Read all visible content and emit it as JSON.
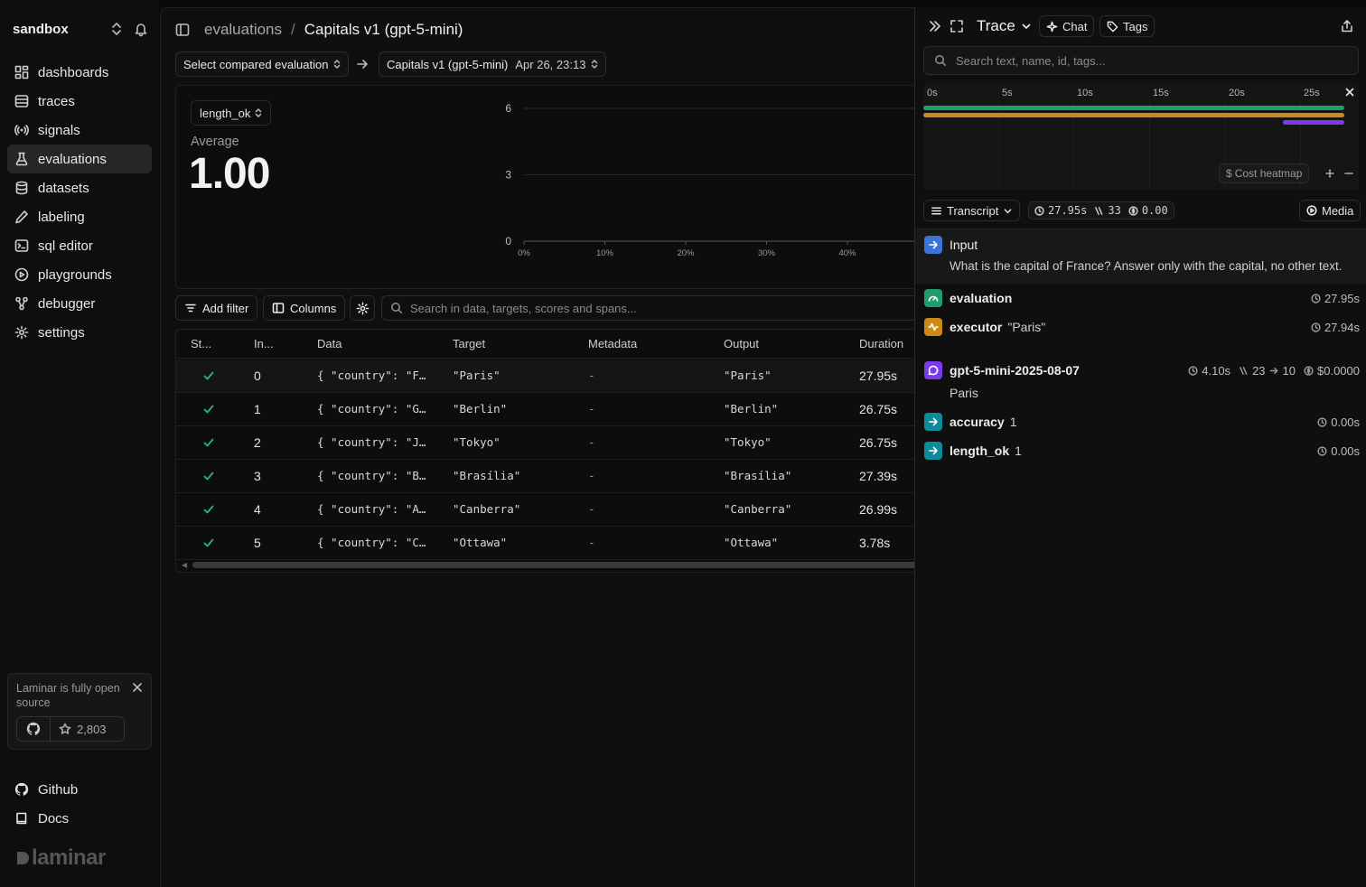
{
  "sidebar": {
    "workspace": "sandbox",
    "items": [
      {
        "label": "dashboards",
        "icon": "dashboard-icon"
      },
      {
        "label": "traces",
        "icon": "list-icon"
      },
      {
        "label": "signals",
        "icon": "signal-icon"
      },
      {
        "label": "evaluations",
        "icon": "flask-icon",
        "active": true
      },
      {
        "label": "datasets",
        "icon": "database-icon"
      },
      {
        "label": "labeling",
        "icon": "pen-icon"
      },
      {
        "label": "sql editor",
        "icon": "terminal-icon"
      },
      {
        "label": "playgrounds",
        "icon": "play-circle-icon"
      },
      {
        "label": "debugger",
        "icon": "share-nodes-icon"
      },
      {
        "label": "settings",
        "icon": "gear-icon"
      }
    ],
    "oss_banner": {
      "text": "Laminar is fully open source",
      "stars": "2,803"
    },
    "footer": {
      "github": "Github",
      "docs": "Docs"
    },
    "brand": "laminar"
  },
  "header": {
    "breadcrumb_parent": "evaluations",
    "breadcrumb_sep": "/",
    "title": "Capitals v1 (gpt-5-mini)"
  },
  "compare": {
    "left_placeholder": "Select compared evaluation",
    "right_name": "Capitals v1 (gpt-5-mini)",
    "right_date": "Apr 26, 23:13"
  },
  "score": {
    "metric": "length_ok",
    "label": "Average",
    "value": "1.00"
  },
  "chart_data": {
    "type": "bar",
    "y_ticks": [
      "6",
      "3",
      "0"
    ],
    "x_ticks": [
      "0%",
      "10%",
      "20%",
      "30%",
      "40%"
    ],
    "ylim": [
      0,
      6
    ],
    "values": []
  },
  "toolbar": {
    "add_filter": "Add filter",
    "columns": "Columns",
    "search_placeholder": "Search in data, targets, scores and spans..."
  },
  "table": {
    "headers": [
      "St...",
      "In...",
      "Data",
      "Target",
      "Metadata",
      "Output",
      "Duration"
    ],
    "rows": [
      {
        "index": "0",
        "data": "{ \"country\": \"F…",
        "target": "\"Paris\"",
        "metadata": "-",
        "output": "\"Paris\"",
        "duration": "27.95s"
      },
      {
        "index": "1",
        "data": "{ \"country\": \"G…",
        "target": "\"Berlin\"",
        "metadata": "-",
        "output": "\"Berlin\"",
        "duration": "26.75s"
      },
      {
        "index": "2",
        "data": "{ \"country\": \"J…",
        "target": "\"Tokyo\"",
        "metadata": "-",
        "output": "\"Tokyo\"",
        "duration": "26.75s"
      },
      {
        "index": "3",
        "data": "{ \"country\": \"B…",
        "target": "\"Brasília\"",
        "metadata": "-",
        "output": "\"Brasília\"",
        "duration": "27.39s"
      },
      {
        "index": "4",
        "data": "{ \"country\": \"A…",
        "target": "\"Canberra\"",
        "metadata": "-",
        "output": "\"Canberra\"",
        "duration": "26.99s"
      },
      {
        "index": "5",
        "data": "{ \"country\": \"C…",
        "target": "\"Ottawa\"",
        "metadata": "-",
        "output": "\"Ottawa\"",
        "duration": "3.78s"
      }
    ]
  },
  "trace_panel": {
    "title": "Trace",
    "chat": "Chat",
    "tags": "Tags",
    "search_placeholder": "Search text, name, id, tags...",
    "timeline_ticks": [
      "0s",
      "5s",
      "10s",
      "15s",
      "20s",
      "25s"
    ],
    "cost_heatmap": "Cost heatmap",
    "cost_symbol": "$",
    "transcript": "Transcript",
    "stats": {
      "duration": "27.95s",
      "tokens": "33",
      "cost": "0.00"
    },
    "media": "Media",
    "input": {
      "label": "Input",
      "text": "What is the capital of France? Answer only with the capital, no other text."
    },
    "spans": {
      "evaluation": {
        "name": "evaluation",
        "duration": "27.95s",
        "color": "#1f9d6b"
      },
      "executor": {
        "name": "executor",
        "value": "\"Paris\"",
        "duration": "27.94s",
        "color": "#c98a16"
      },
      "llm": {
        "name": "gpt-5-mini-2025-08-07",
        "duration": "4.10s",
        "tokens_in": "23",
        "tokens_out": "10",
        "cost": "$0.0000",
        "output": "Paris",
        "color": "#7c3aed"
      },
      "accuracy": {
        "name": "accuracy",
        "value": "1",
        "duration": "0.00s",
        "color": "#0e8a9a"
      },
      "length_ok": {
        "name": "length_ok",
        "value": "1",
        "duration": "0.00s",
        "color": "#0e8a9a"
      }
    }
  }
}
